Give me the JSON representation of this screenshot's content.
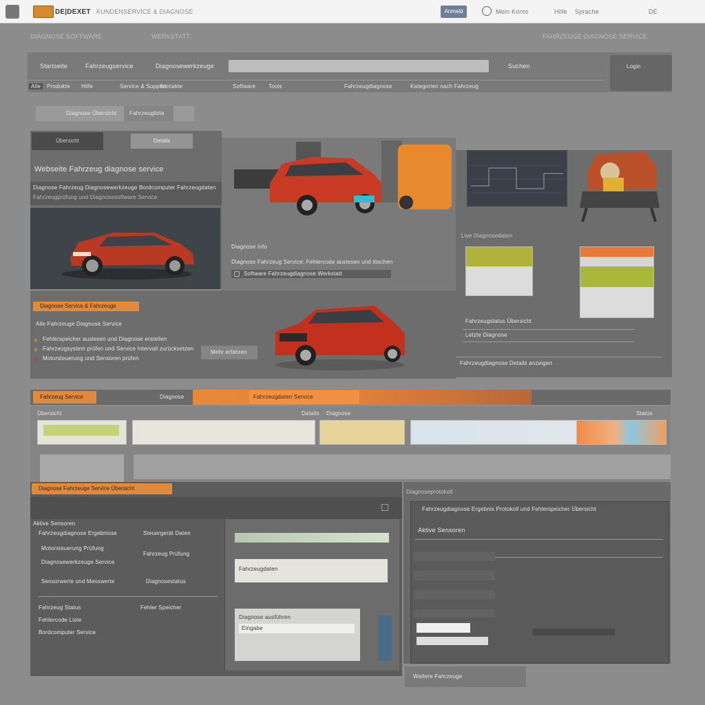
{
  "topbar": {
    "brand": "DE|DEXET",
    "tagline": "KUNDENSERVICE & DIAGNOSE",
    "button_label": "Anmeld",
    "account_text": "Mein Konto",
    "links": [
      "Hilfe",
      "Sprache",
      "DE"
    ]
  },
  "header": {
    "left_label": "DIAGNOSE SOFTWARE",
    "center_label": "WERKSTATT",
    "right_label": "FAHRZEUGE DIAGNOSE SERVICE"
  },
  "nav": {
    "items": [
      "Startseite",
      "Fahrzeugservice",
      "Diagnosewerkzeuge"
    ],
    "search_placeholder": "",
    "search_button": "Suchen",
    "right_button": "Login",
    "subnav": [
      "Alle",
      "Produkte",
      "Hilfe",
      "Service & Support",
      "Kontakte",
      "Software",
      "Tools",
      "Fahrzeugdiagnose",
      "Kategorien nach Fahrzeug"
    ]
  },
  "tabs": {
    "buttons": [
      "Diagnose Übersicht",
      "Fahrzeugliste"
    ],
    "active_tab": "Übersicht",
    "inactive_tab": "Details"
  },
  "hero": {
    "title": "Webseite Fahrzeug diagnose service",
    "text_line1": "Diagnose Fahrzeug Diagnosewerkzeuge Bordcomputer Fahrzeugdaten",
    "text_line2": "Fahrzeugprüfung und Diagnosesoftware Service",
    "mid_label": "Diagnose Info",
    "mid_text": "Diagnose Fahrzeug Service: Fehlercode auslesen und löschen",
    "mid_link": "Software Fahrzeugdiagnose Werkstatt"
  },
  "right_panel": {
    "label": "Live Diagnosedaten",
    "line1": "Fahrzeugstatus Übersicht",
    "line2": "Letzte Diagnose",
    "footer": "Fahrzeugdiagnose Details anzeigen"
  },
  "promo": {
    "badge": "Diagnose Service & Fahrzeuge",
    "heading": "Alle Fahrzeuge Diagnose Service",
    "bullets": [
      "Fehlerspeicher auslesen und Diagnose erstellen",
      "Fahrzeugsystem prüfen und Service Intervall zurücksetzen",
      "Motorsteuerung und Sensoren prüfen"
    ],
    "button": "Mehr erfahren"
  },
  "strip": {
    "tabs": [
      "Fahrzeug Service",
      "Diagnose",
      "Fahrzeugdaten Service"
    ],
    "labels": [
      "Übersicht",
      "Details",
      "Diagnose",
      "Status"
    ]
  },
  "bottom": {
    "badge": "Diagnose Fahrzeuge Service Übersicht",
    "right_label": "Diagnoseprotokoll",
    "right_title": "Fahrzeugdiagnose Ergebnis Protokoll und Fehlerspeicher Übersicht",
    "section": "Aktive Sensoren",
    "left_rows": [
      "Fahrzeugdiagnose Ergebnisse",
      "Motorsteuerung Prüfung",
      "Diagnosewerkzeuge Service",
      "Sensorwerte und Messwerte",
      "Fahrzeug Status",
      "Fehlercode Liste",
      "Bordcomputer Service"
    ],
    "mid_rows": [
      "Steuergerät Daten",
      "Fahrzeug Prüfung",
      "Diagnosestatus",
      "Fehler Speicher"
    ],
    "dialog_title": "Diagnose ausführen",
    "dialog_field": "Fahrzeugdaten",
    "dialog_value": "Eingabe",
    "footer_link": "Weitere Fahrzeuge"
  },
  "colors": {
    "accent": "#e08a3e",
    "background": "#8c8c8c",
    "topbar": "#f4f4f4"
  }
}
